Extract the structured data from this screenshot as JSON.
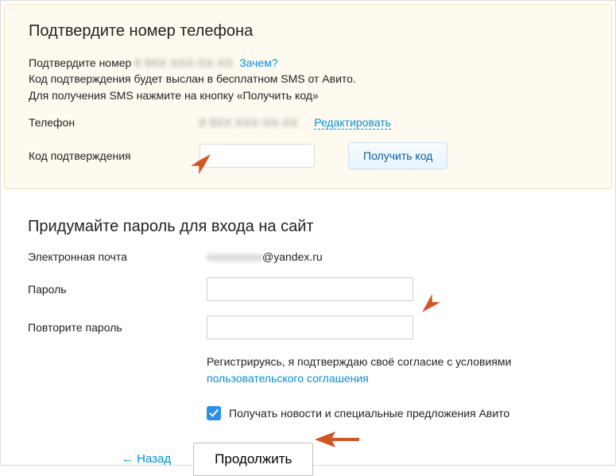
{
  "verify": {
    "title": "Подтвердите номер телефона",
    "confirm_prefix": "Подтвердите номер ",
    "confirm_number": "8 9XX XXX-XX-XX",
    "why_link": "Зачем?",
    "line2": "Код подтверждения будет выслан в бесплатном SMS от Авито.",
    "line3": "Для получения SMS нажмите на кнопку «Получить код»",
    "phone_label": "Телефон",
    "phone_value": "8 9XX XXX-XX-XX",
    "edit_link": "Редактировать",
    "code_label": "Код подтверждения",
    "code_value": "",
    "get_code_btn": "Получить код"
  },
  "password_section": {
    "title": "Придумайте пароль для входа на сайт",
    "email_label": "Электронная почта",
    "email_user": "xxxxxxxxxx",
    "email_domain": "@yandex.ru",
    "pw_label": "Пароль",
    "pw_value": "",
    "pw2_label": "Повторите пароль",
    "pw2_value": "",
    "agree_text_pre": "Регистрируясь, я подтверждаю своё согласие с условиями ",
    "agree_link": "пользовательского соглашения",
    "news_checked": true,
    "news_label": "Получать новости и специальные предложения Авито"
  },
  "actions": {
    "back": "← Назад",
    "continue": "Продолжить"
  }
}
